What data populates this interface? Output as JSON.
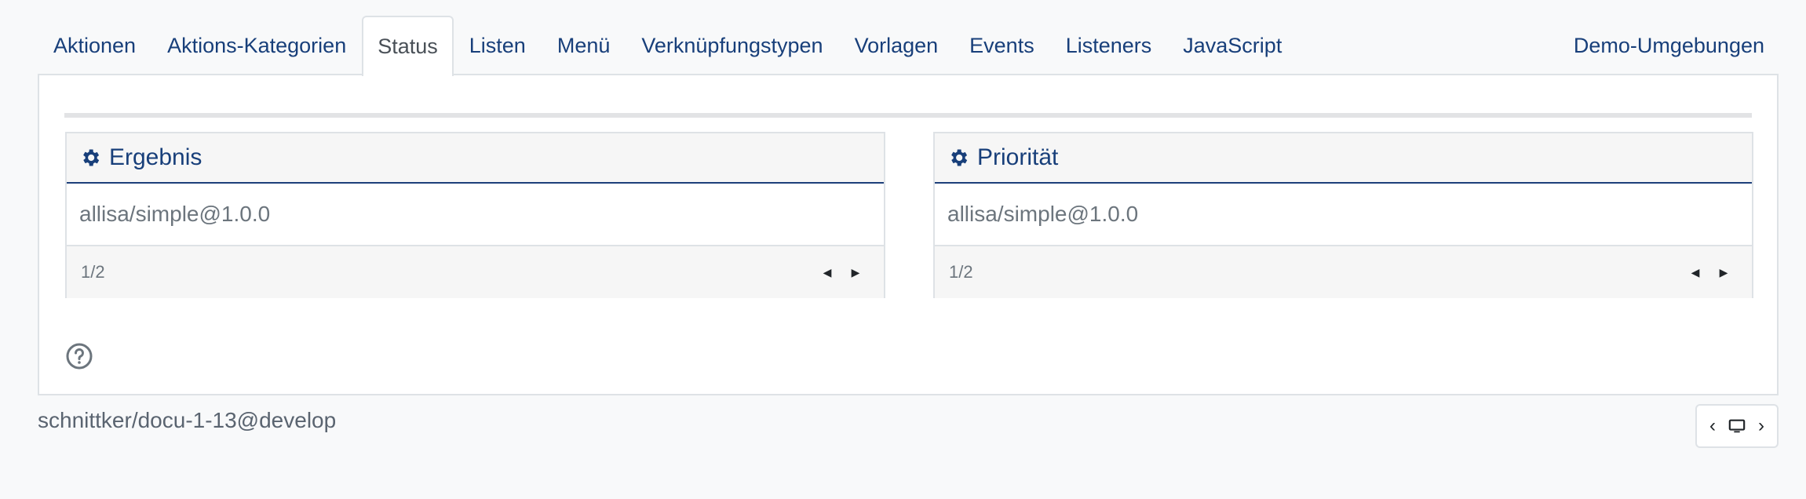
{
  "tabs": [
    {
      "label": "Aktionen",
      "active": false
    },
    {
      "label": "Aktions-Kategorien",
      "active": false
    },
    {
      "label": "Status",
      "active": true
    },
    {
      "label": "Listen",
      "active": false
    },
    {
      "label": "Menü",
      "active": false
    },
    {
      "label": "Verknüpfungstypen",
      "active": false
    },
    {
      "label": "Vorlagen",
      "active": false
    },
    {
      "label": "Events",
      "active": false
    },
    {
      "label": "Listeners",
      "active": false
    },
    {
      "label": "JavaScript",
      "active": false
    }
  ],
  "right_tab": {
    "label": "Demo-Umgebungen"
  },
  "cards": [
    {
      "title": "Ergebnis",
      "icon": "gear-icon",
      "value": "allisa/simple@1.0.0",
      "pager": "1/2"
    },
    {
      "title": "Priorität",
      "icon": "gear-icon",
      "value": "allisa/simple@1.0.0",
      "pager": "1/2"
    }
  ],
  "footer": {
    "branch": "schnittker/docu-1-13@develop"
  },
  "icons": {
    "help": "question-circle-icon",
    "environment": "monitor-icon"
  },
  "colors": {
    "primary": "#183f7a",
    "muted": "#6c757d",
    "border": "#dee2e6"
  }
}
